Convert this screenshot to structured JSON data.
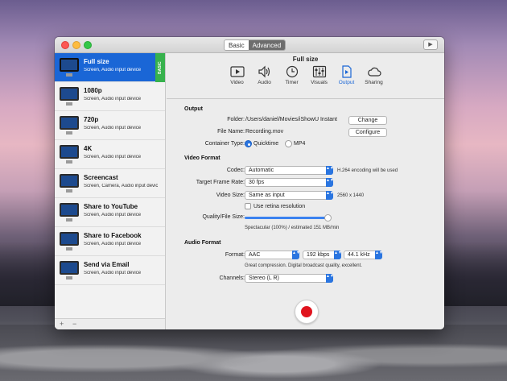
{
  "window": {
    "segments": [
      "Basic",
      "Advanced"
    ],
    "title_button_icon": "play-icon"
  },
  "sidebar": {
    "items": [
      {
        "name": "Full size",
        "sub": "Screen, Audio input device",
        "selected": true,
        "tag": "BASIC"
      },
      {
        "name": "1080p",
        "sub": "Screen, Audio input device"
      },
      {
        "name": "720p",
        "sub": "Screen, Audio input device"
      },
      {
        "name": "4K",
        "sub": "Screen, Audio input device"
      },
      {
        "name": "Screencast",
        "sub": "Screen, Camera, Audio input device"
      },
      {
        "name": "Share to YouTube",
        "sub": "Screen, Audio input device"
      },
      {
        "name": "Share to Facebook",
        "sub": "Screen, Audio input device"
      },
      {
        "name": "Send via Email",
        "sub": "Screen, Audio input device"
      }
    ],
    "add_label": "+",
    "remove_label": "−"
  },
  "main": {
    "title": "Full size",
    "tabs": [
      {
        "label": "Video",
        "icon": "video-icon"
      },
      {
        "label": "Audio",
        "icon": "speaker-icon"
      },
      {
        "label": "Timer",
        "icon": "clock-icon"
      },
      {
        "label": "Visuals",
        "icon": "sliders-icon"
      },
      {
        "label": "Output",
        "icon": "output-file-icon",
        "active": true
      },
      {
        "label": "Sharing",
        "icon": "cloud-icon"
      }
    ]
  },
  "output": {
    "heading": "Output",
    "folder_label": "Folder:",
    "folder_value": "/Users/daniel/Movies/iShowU Instant",
    "change_button": "Change",
    "filename_label": "File Name:",
    "filename_value": "Recording.mov",
    "configure_button": "Configure",
    "container_label": "Container Type:",
    "container_options": [
      "Quicktime",
      "MP4"
    ],
    "container_selected": "Quicktime"
  },
  "video": {
    "heading": "Video Format",
    "codec_label": "Codec:",
    "codec_value": "Automatic",
    "codec_note": "H.264 encoding will be used",
    "framerate_label": "Target Frame Rate:",
    "framerate_value": "30 fps",
    "size_label": "Video Size:",
    "size_value": "Same as input",
    "size_note": "2560 x 1440",
    "retina_label": "Use retina resolution",
    "retina_checked": false,
    "quality_label": "Quality/File Size:",
    "quality_level_fraction": 1.0,
    "quality_note": "Spectacular (100%) / estimated 151 MB/min"
  },
  "audio": {
    "heading": "Audio Format",
    "format_label": "Format:",
    "format_value": "AAC",
    "bitrate_value": "192 kbps",
    "samplerate_value": "44.1 kHz",
    "format_note": "Great compression. Digital broadcast quality, excellent.",
    "channels_label": "Channels:",
    "channels_value": "Stereo (L R)"
  },
  "colors": {
    "accent": "#1a66d6",
    "basic_tag": "#37b24d",
    "record": "#e0141e"
  }
}
